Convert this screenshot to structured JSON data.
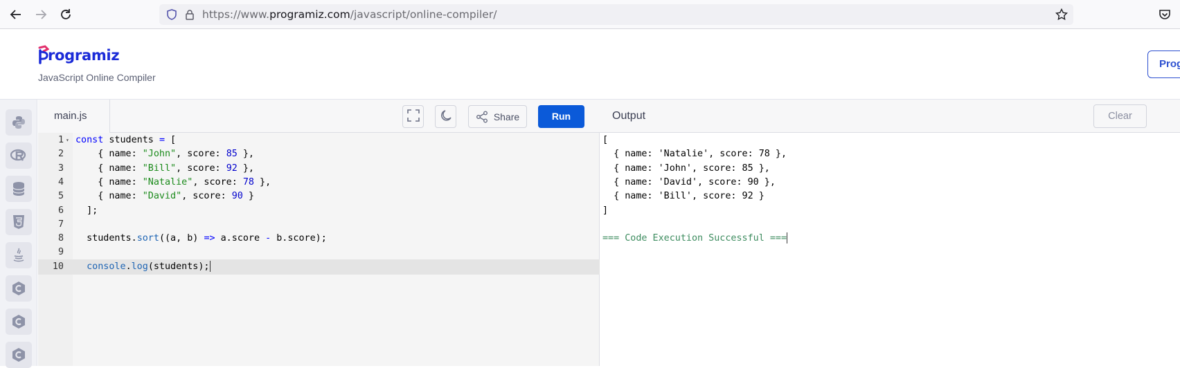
{
  "browser": {
    "url_prefix": "https://www.",
    "url_domain": "programiz.com",
    "url_path": "/javascript/online-compiler/"
  },
  "header": {
    "logo_text": "rogramiz",
    "subtitle": "JavaScript Online Compiler",
    "pro_button": "Prog"
  },
  "sidebar": {
    "items": [
      {
        "icon": "python-icon"
      },
      {
        "icon": "r-icon"
      },
      {
        "icon": "sql-icon"
      },
      {
        "icon": "html5-icon"
      },
      {
        "icon": "java-icon"
      },
      {
        "icon": "c-icon"
      },
      {
        "icon": "cpp-icon"
      },
      {
        "icon": "csharp-icon"
      }
    ]
  },
  "editor": {
    "file_tab": "main.js",
    "share_label": "Share",
    "run_label": "Run",
    "active_line": 10,
    "lines": [
      {
        "num": "1",
        "text": "const students = ["
      },
      {
        "num": "2",
        "text": "    { name: \"John\", score: 85 },"
      },
      {
        "num": "3",
        "text": "    { name: \"Bill\", score: 92 },"
      },
      {
        "num": "4",
        "text": "    { name: \"Natalie\", score: 78 },"
      },
      {
        "num": "5",
        "text": "    { name: \"David\", score: 90 }"
      },
      {
        "num": "6",
        "text": "  ];"
      },
      {
        "num": "7",
        "text": ""
      },
      {
        "num": "8",
        "text": "  students.sort((a, b) => a.score - b.score);"
      },
      {
        "num": "9",
        "text": ""
      },
      {
        "num": "10",
        "text": "  console.log(students);"
      }
    ]
  },
  "output": {
    "title": "Output",
    "clear_label": "Clear",
    "lines": [
      "[",
      "  { name: 'Natalie', score: 78 },",
      "  { name: 'John', score: 85 },",
      "  { name: 'David', score: 90 },",
      "  { name: 'Bill', score: 92 }",
      "]",
      "",
      "=== Code Execution Successful ==="
    ]
  },
  "colors": {
    "brand": "#1b2bd8",
    "run_button": "#0b5ad9",
    "success_text": "#3d8c5f"
  }
}
